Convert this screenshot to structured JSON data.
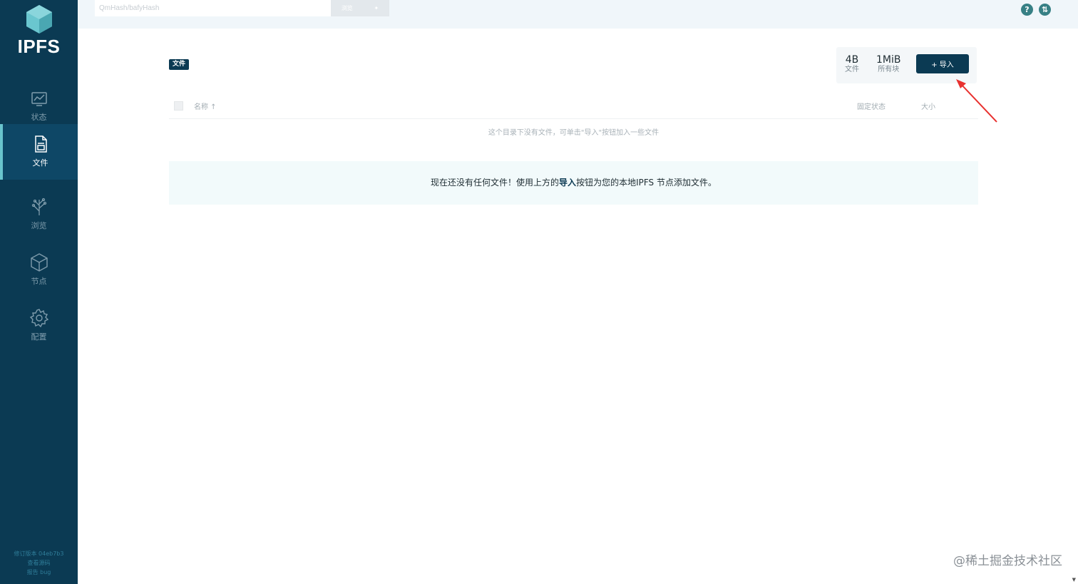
{
  "app": {
    "logo_text": "IPFS"
  },
  "sidebar": {
    "items": [
      {
        "label": "状态",
        "icon": "status-chart-icon",
        "active": false
      },
      {
        "label": "文件",
        "icon": "files-icon",
        "active": true
      },
      {
        "label": "浏览",
        "icon": "explore-tree-icon",
        "active": false
      },
      {
        "label": "节点",
        "icon": "peers-cube-icon",
        "active": false
      },
      {
        "label": "配置",
        "icon": "settings-gear-icon",
        "active": false
      }
    ],
    "footer": {
      "revision": "修订版本 04eb7b3",
      "source": "查看源码",
      "report": "报告 bug"
    }
  },
  "search": {
    "placeholder": "QmHash/bafyHash",
    "browse_label": "浏览"
  },
  "header": {
    "breadcrumb": "文件",
    "stats": {
      "files_value": "4B",
      "files_label": "文件",
      "blocks_value": "1MiB",
      "blocks_label": "所有块"
    },
    "import_label": "+ 导入"
  },
  "table": {
    "col_name": "名称 ↑",
    "col_pin": "固定状态",
    "col_size": "大小",
    "empty_text": "这个目录下没有文件，可单击\"导入\"按钮加入一些文件"
  },
  "notice": {
    "before": "现在还没有任何文件！使用上方的",
    "bold": "导入",
    "after": "按钮为您的本地IPFS 节点添加文件。"
  },
  "watermark": "@稀土掘金技术社区",
  "colors": {
    "sidebar_bg": "#0b3a53",
    "accent": "#69c4cd",
    "import_button": "#0b3a53",
    "annotation_arrow": "#e8312f"
  }
}
